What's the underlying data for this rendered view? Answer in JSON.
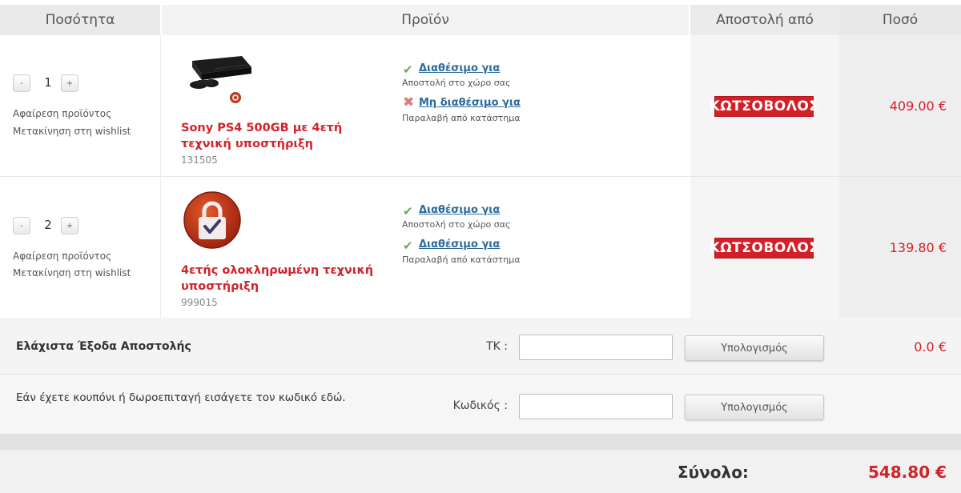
{
  "header": {
    "quantity": "Ποσότητα",
    "product": "Προϊόν",
    "ship_from": "Αποστολή από",
    "amount": "Ποσό"
  },
  "items": [
    {
      "qty": "1",
      "minus": "-",
      "plus": "+",
      "remove": "Αφαίρεση προϊόντος",
      "wishlist": "Μετακίνηση στη wishlist",
      "name": "Sony PS4 500GB με 4ετή τεχνική υποστήριξη",
      "sku": "131505",
      "avail1_link": "Διαθέσιμο για",
      "avail1_sub": "Αποστολή στο χώρο σας",
      "avail2_link": "Μη διαθέσιμο για",
      "avail2_sub": "Παραλαβή από κατάστημα",
      "store": "ΚΩΤΣΟΒΟΛΟΣ",
      "price": "409.00 €"
    },
    {
      "qty": "2",
      "minus": "-",
      "plus": "+",
      "remove": "Αφαίρεση προϊόντος",
      "wishlist": "Μετακίνηση στη wishlist",
      "name": "4ετής ολοκληρωμένη τεχνική υποστήριξη",
      "sku": "999015",
      "avail1_link": "Διαθέσιμο για",
      "avail1_sub": "Αποστολή στο χώρο σας",
      "avail2_link": "Διαθέσιμο για",
      "avail2_sub": "Παραλαβή από κατάστημα",
      "store": "ΚΩΤΣΟΒΟΛΟΣ",
      "price": "139.80 €"
    }
  ],
  "shipping": {
    "label": "Ελάχιστα Έξοδα Αποστολής",
    "zip_label": "ΤΚ :",
    "zip_value": "",
    "button": "Υπολογισμός",
    "amount": "0.0 €"
  },
  "coupon": {
    "label": "Εάν έχετε κουπόνι ή δωροεπιταγή εισάγετε τον κωδικό εδώ.",
    "code_label": "Κωδικός :",
    "code_value": "",
    "button": "Υπολογισμός"
  },
  "total": {
    "label": "Σύνολο:",
    "value": "548.80 €"
  },
  "colors": {
    "accent_red": "#d2232a",
    "link_blue": "#2b6b9e",
    "ok_green": "#6aa84f",
    "no_red": "#e07a7a"
  }
}
